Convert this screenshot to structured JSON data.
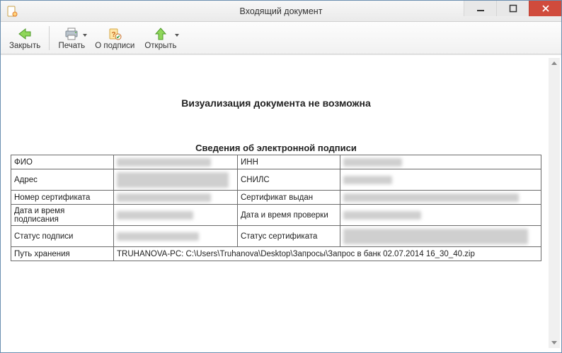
{
  "window": {
    "title": "Входящий документ"
  },
  "toolbar": {
    "close_label": "Закрыть",
    "print_label": "Печать",
    "signature_info_label": "О подписи",
    "open_label": "Открыть"
  },
  "document": {
    "message": "Визуализация документа не возможна",
    "signature_section_title": "Сведения об электронной подписи",
    "fields": {
      "fio_label": "ФИО",
      "fio_value": "",
      "inn_label": "ИНН",
      "inn_value": "",
      "address_label": "Адрес",
      "address_value": "",
      "snils_label": "СНИЛС",
      "snils_value": "",
      "cert_no_label": "Номер сертификата",
      "cert_no_value": "",
      "cert_issued_label": "Сертификат выдан",
      "cert_issued_value": "",
      "sign_dt_label": "Дата и время подписания",
      "sign_dt_value": "",
      "check_dt_label": "Дата и время проверки",
      "check_dt_value": "",
      "sign_status_label": "Статус подписи",
      "sign_status_value": "",
      "cert_status_label": "Статус сертификата",
      "cert_status_value": "",
      "storage_path_label": "Путь хранения",
      "storage_path_value": "TRUHANOVA-PC: C:\\Users\\Truhanova\\Desktop\\Запросы\\Запрос в банк 02.07.2014 16_30_40.zip"
    }
  }
}
